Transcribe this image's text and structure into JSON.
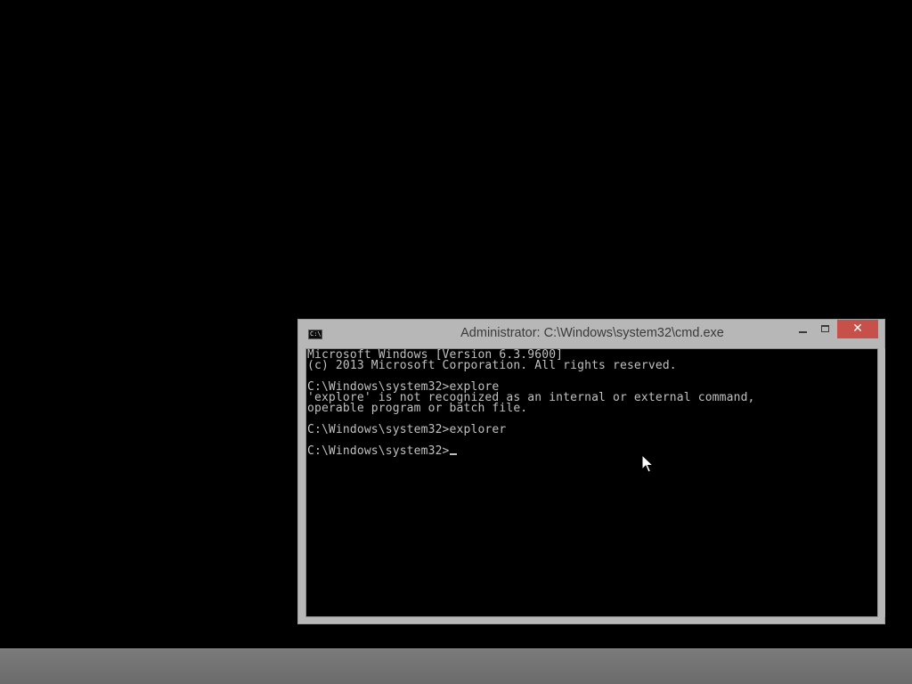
{
  "window": {
    "title": "Administrator: C:\\Windows\\system32\\cmd.exe",
    "icon_label": "C:\\",
    "controls": {
      "minimize": "minimize",
      "maximize": "maximize",
      "close": "✕"
    }
  },
  "console": {
    "lines": [
      "Microsoft Windows [Version 6.3.9600]",
      "(c) 2013 Microsoft Corporation. All rights reserved.",
      "",
      "C:\\Windows\\system32>explore",
      "'explore' is not recognized as an internal or external command,",
      "operable program or batch file.",
      "",
      "C:\\Windows\\system32>explorer",
      "",
      "C:\\Windows\\system32>"
    ]
  },
  "colors": {
    "desktop": "#000000",
    "window_frame": "#b7b7b7",
    "close_button": "#c7504a",
    "console_bg": "#000000",
    "console_text": "#c0c0c0",
    "taskbar": "#707070"
  },
  "icons": {
    "app_icon": "cmd-icon",
    "pointer": "mouse-pointer-icon"
  }
}
